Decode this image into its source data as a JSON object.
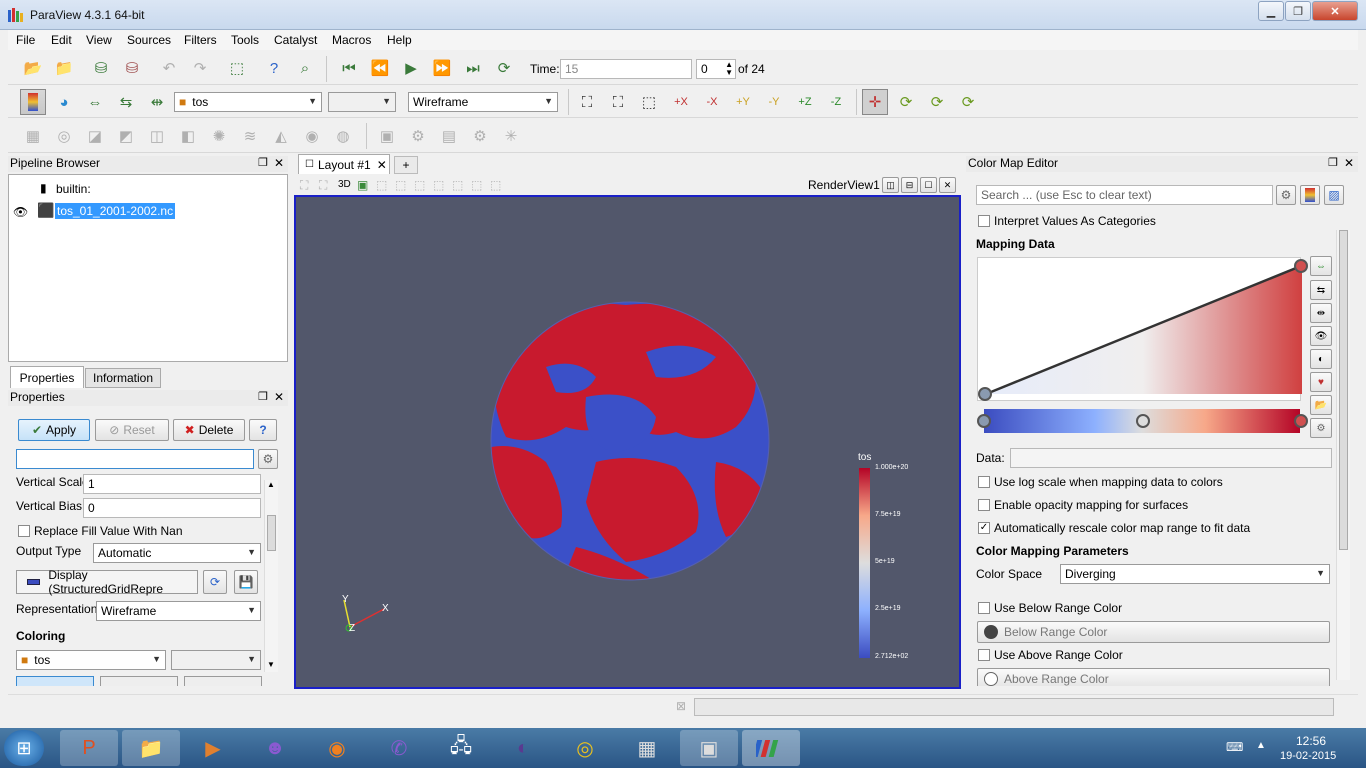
{
  "window": {
    "title": "ParaView 4.3.1 64-bit",
    "min_icon": "minimize-icon",
    "max_icon": "maximize-icon",
    "close_icon": "close-icon"
  },
  "menu": [
    "File",
    "Edit",
    "View",
    "Sources",
    "Filters",
    "Tools",
    "Catalyst",
    "Macros",
    "Help"
  ],
  "time": {
    "label": "Time:",
    "value": "15",
    "index": "0",
    "of": "of 24"
  },
  "toolbar2": {
    "array": "tos",
    "component": "",
    "representation": "Wireframe"
  },
  "pipeline": {
    "title": "Pipeline Browser",
    "root": "builtin:",
    "item": "tos_01_2001-2002.nc"
  },
  "prop_tabs": [
    "Properties",
    "Information"
  ],
  "properties": {
    "title": "Properties",
    "apply": "Apply",
    "reset": "Reset",
    "delete": "Delete",
    "help": "?",
    "search_value": "",
    "vertical_scale_label": "Vertical Scale",
    "vertical_scale": "1",
    "vertical_bias_label": "Vertical Bias",
    "vertical_bias": "0",
    "replace_fill": "Replace Fill Value With Nan",
    "output_type_label": "Output Type",
    "output_type": "Automatic",
    "display": "Display (StructuredGridRepre",
    "representation_label": "Representation",
    "representation": "Wireframe",
    "coloring": "Coloring",
    "coloring_array": "tos"
  },
  "layout": {
    "tab": "Layout #1",
    "add": "+",
    "view_name": "RenderView1",
    "mode_3d": "3D"
  },
  "legend": {
    "title": "tos",
    "max": "1.000e+20",
    "t1": "7.5e+19",
    "t2": "5e+19",
    "t3": "2.5e+19",
    "min": "2.712e+02"
  },
  "axes": {
    "x": "X",
    "y": "Y",
    "z": "Z"
  },
  "colormap": {
    "title": "Color Map Editor",
    "search_placeholder": "Search ... (use Esc to clear text)",
    "interpret": "Interpret Values As Categories",
    "mapping_data": "Mapping Data",
    "data_label": "Data:",
    "log_scale": "Use log scale when mapping data to colors",
    "opacity": "Enable opacity mapping for surfaces",
    "rescale": "Automatically rescale color map range to fit data",
    "params": "Color Mapping Parameters",
    "color_space_label": "Color Space",
    "color_space": "Diverging",
    "below_check": "Use Below Range Color",
    "below": "Below Range Color",
    "above_check": "Use Above Range Color",
    "above": "Above Range Color"
  },
  "clock": {
    "time": "12:56",
    "date": "19-02-2015"
  },
  "colors": {
    "accent": "#3399ff",
    "ramp_low": "#3b4cc0",
    "ramp_high": "#b40426",
    "render_bg": "#52576b"
  }
}
